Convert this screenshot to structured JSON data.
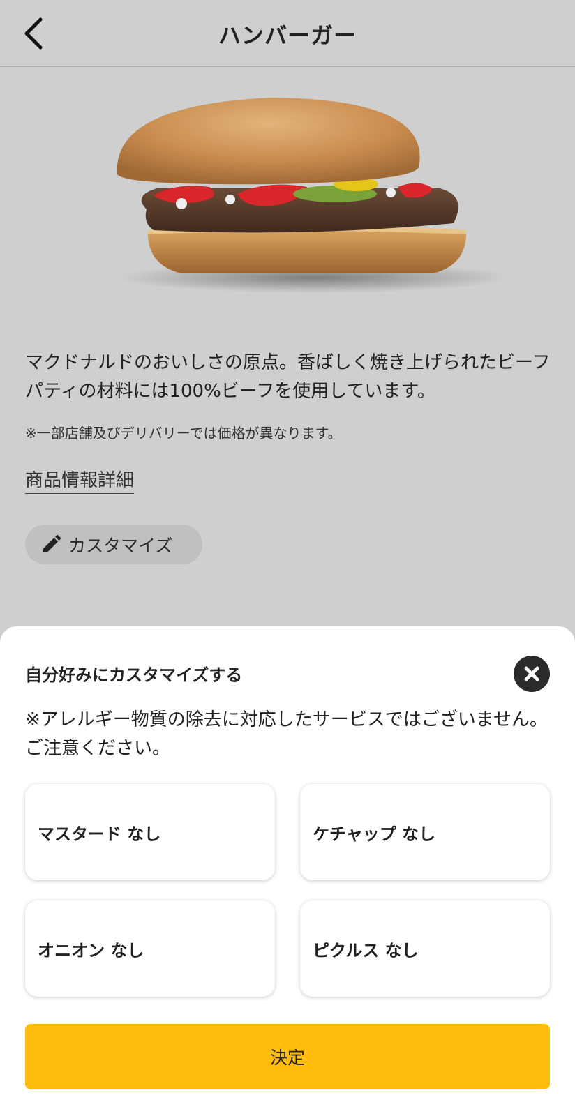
{
  "header": {
    "title": "ハンバーガー",
    "back_icon": "chevron-left-icon"
  },
  "product": {
    "image": "hamburger-photo",
    "description": "マクドナルドのおいしさの原点。香ばしく焼き上げられたビーフパティの材料には100%ビーフを使用しています。",
    "price_note": "※一部店舗及びデリバリーでは価格が異なります。",
    "details_link": "商品情報詳細",
    "customize_chip": {
      "label": "カスタマイズ",
      "icon": "pencil-icon"
    }
  },
  "customize_sheet": {
    "title": "自分好みにカスタマイズする",
    "close_icon": "close-icon",
    "warning": "※アレルギー物質の除去に対応したサービスではございません。ご注意ください。",
    "options": [
      {
        "label": "マスタード なし"
      },
      {
        "label": "ケチャップ なし"
      },
      {
        "label": "オニオン なし"
      },
      {
        "label": "ピクルス なし"
      }
    ],
    "confirm_label": "決定"
  },
  "colors": {
    "overlay_background": "#cfcfcf",
    "accent": "#ffbc0d",
    "close_button": "#2b2b2b"
  }
}
